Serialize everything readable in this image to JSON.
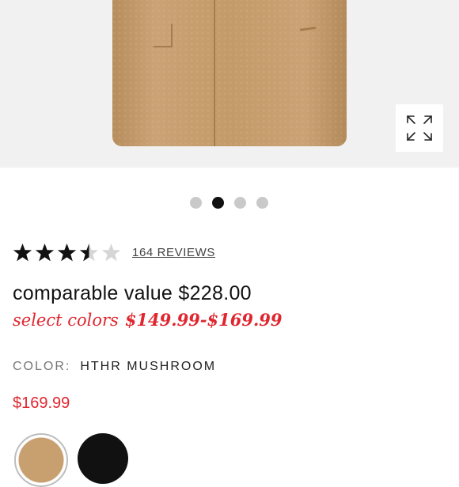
{
  "gallery": {
    "image_alt": "camel wool coat",
    "expand_icon": "expand-arrows-icon",
    "dots": [
      {
        "active": false
      },
      {
        "active": true
      },
      {
        "active": false
      },
      {
        "active": false
      }
    ]
  },
  "rating": {
    "value": 3.5,
    "max": 5,
    "reviews_label": "164 REVIEWS"
  },
  "pricing": {
    "comparable": "comparable value $228.00",
    "sale_prefix": "select colors",
    "sale_range": "$149.99-$169.99",
    "current_price": "$169.99"
  },
  "color": {
    "label": "COLOR:",
    "selected": "HTHR MUSHROOM"
  },
  "swatches": [
    {
      "name": "HTHR MUSHROOM",
      "color": "#c89f6e",
      "selected": true
    },
    {
      "name": "BLACK",
      "color": "#111111",
      "selected": false
    }
  ],
  "colors": {
    "sale_red": "#e0262f",
    "star": "#111111",
    "star_empty": "#d6d6d6"
  }
}
